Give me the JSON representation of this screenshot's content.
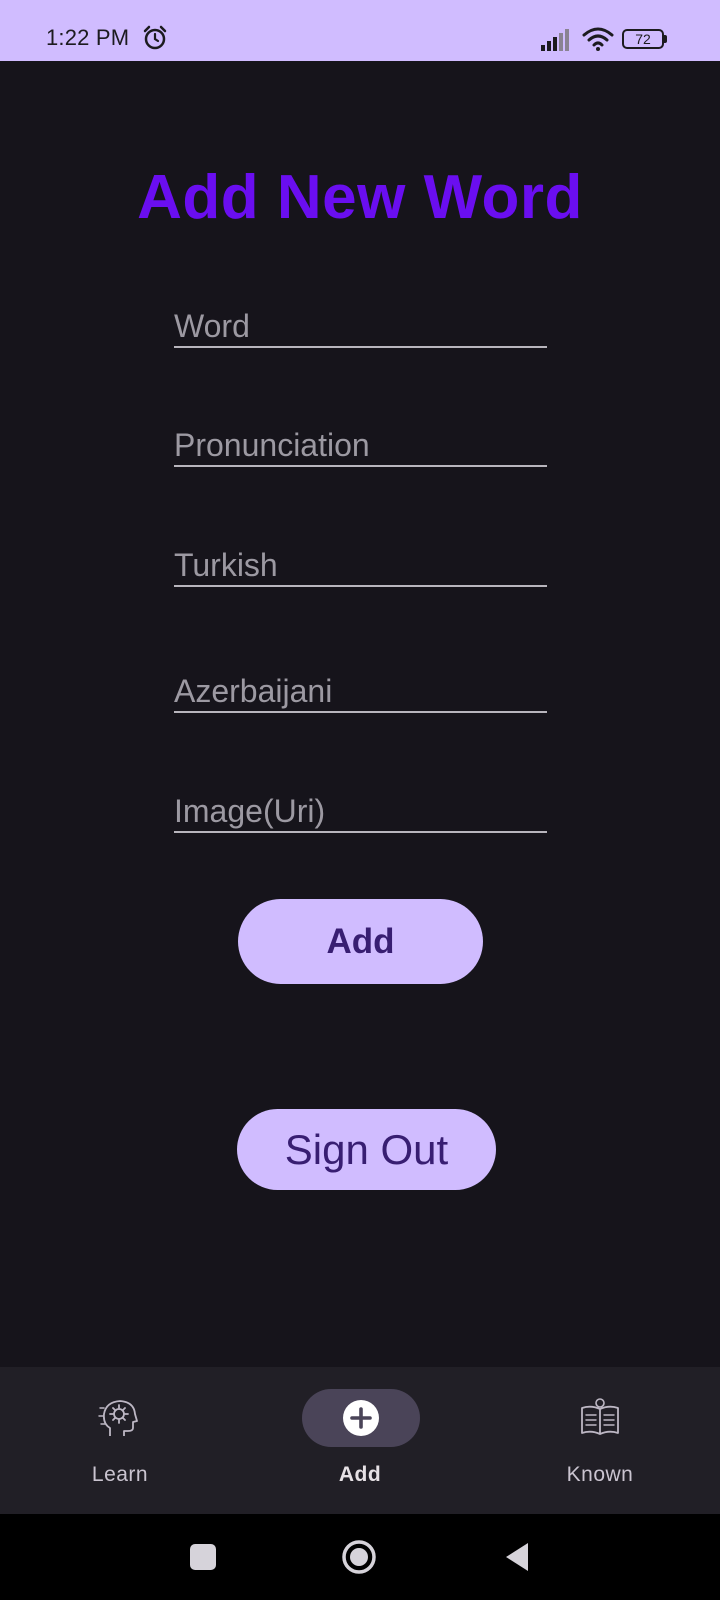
{
  "status_bar": {
    "time": "1:22 PM",
    "battery_level": "72",
    "icons": [
      "alarm-icon",
      "signal-icon",
      "wifi-icon",
      "battery-icon"
    ]
  },
  "form": {
    "title": "Add New Word",
    "fields": [
      {
        "placeholder": "Word",
        "value": ""
      },
      {
        "placeholder": "Pronunciation",
        "value": ""
      },
      {
        "placeholder": "Turkish",
        "value": ""
      },
      {
        "placeholder": "Azerbaijani",
        "value": ""
      },
      {
        "placeholder": "Image(Uri)",
        "value": ""
      }
    ],
    "add_label": "Add",
    "sign_out_label": "Sign Out"
  },
  "bottom_nav": {
    "items": [
      {
        "label": "Learn",
        "icon": "brain-gear-icon",
        "selected": false
      },
      {
        "label": "Add",
        "icon": "plus-circle-icon",
        "selected": true
      },
      {
        "label": "Known",
        "icon": "open-book-icon",
        "selected": false
      }
    ]
  },
  "system_nav": {
    "icons": [
      "recent-apps-icon",
      "home-icon",
      "back-icon"
    ]
  },
  "colors": {
    "background": "#16141b",
    "status_bar": "#d0bcff",
    "title": "#6a0ef0",
    "button_bg": "#d0bcff",
    "button_text": "#381e72",
    "nav_bar": "#211f26",
    "nav_selected_pill": "#4a4458"
  }
}
